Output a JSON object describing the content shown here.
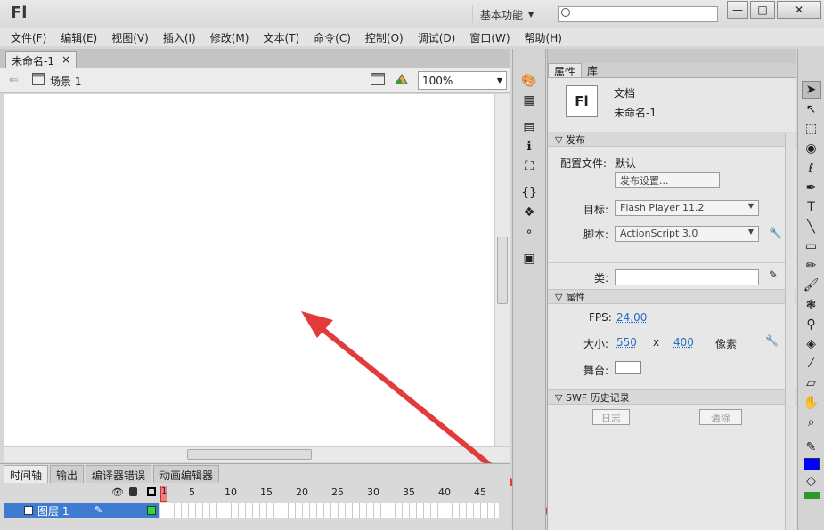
{
  "app": {
    "logo": "Fl",
    "workspace": "基本功能",
    "search_placeholder": ""
  },
  "menu": [
    "文件(F)",
    "编辑(E)",
    "视图(V)",
    "插入(I)",
    "修改(M)",
    "文本(T)",
    "命令(C)",
    "控制(O)",
    "调试(D)",
    "窗口(W)",
    "帮助(H)"
  ],
  "document_tab": {
    "label": "未命名-1",
    "close": "×"
  },
  "edit_bar": {
    "scene": "场景 1",
    "zoom": "100%"
  },
  "timeline": {
    "tabs": [
      "时间轴",
      "输出",
      "编译器错误",
      "动画编辑器"
    ],
    "frame_numbers": [
      "1",
      "5",
      "10",
      "15",
      "20",
      "25",
      "30",
      "35",
      "40",
      "45"
    ],
    "layer": "图层 1"
  },
  "properties": {
    "tabs": [
      "属性",
      "库"
    ],
    "doc_icon": "Fl",
    "doc_type": "文档",
    "doc_name": "未命名-1",
    "publish_section": "发布",
    "profile_label": "配置文件:",
    "profile_value": "默认",
    "publish_settings_button": "发布设置...",
    "target_label": "目标:",
    "target_value": "Flash Player 11.2",
    "script_label": "脚本:",
    "script_value": "ActionScript 3.0",
    "class_label": "类:",
    "class_value": "",
    "properties_section": "属性",
    "fps_label": "FPS:",
    "fps_value": "24.00",
    "size_label": "大小:",
    "width": "550",
    "x": "x",
    "height": "400",
    "unit": "像素",
    "stage_label": "舞台:",
    "swf_section": "SWF 历史记录",
    "log_button": "日志",
    "clear_button": "清除"
  },
  "colors": {
    "stroke": "#000000",
    "fill": "#0000ff",
    "arrow": "#e23b3b"
  }
}
